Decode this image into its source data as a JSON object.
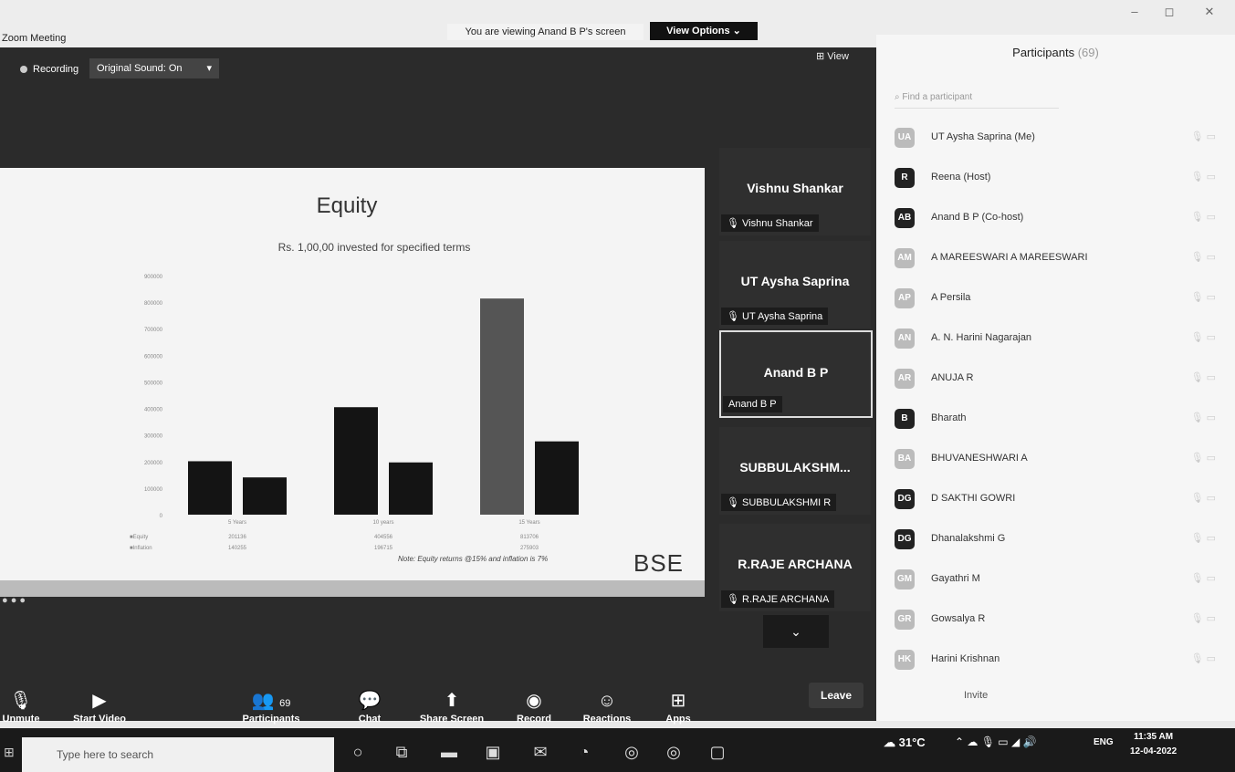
{
  "window": {
    "title": "Zoom Meeting",
    "viewing_text": "You are viewing Anand B P's screen",
    "view_options": "View Options ⌄",
    "minimize": "–",
    "maximize": "◻",
    "close": "✕"
  },
  "meeting_bar": {
    "recording": "Recording",
    "sound": "Original Sound: On",
    "sound_caret": "▾",
    "view": "⊞ View"
  },
  "slide": {
    "title": "Equity",
    "subtitle": "Rs. 1,00,00 invested for specified terms",
    "note": "Note: Equity returns @15% and inflation is 7%",
    "logo": "BSE"
  },
  "chart_data": {
    "type": "bar",
    "categories": [
      "5 Years",
      "10 years",
      "15 Years"
    ],
    "series": [
      {
        "name": "Equity",
        "values": [
          201136,
          404556,
          813706
        ]
      },
      {
        "name": "Inflation",
        "values": [
          140255,
          196715,
          275903
        ]
      }
    ],
    "yticks": [
      "900000",
      "800000",
      "700000",
      "600000",
      "500000",
      "400000",
      "300000",
      "200000",
      "100000",
      "0"
    ],
    "table_rows": [
      {
        "label": "■Equity",
        "values": [
          "201136",
          "404556",
          "813706"
        ]
      },
      {
        "label": "■Inflation",
        "values": [
          "140255",
          "196715",
          "275903"
        ]
      }
    ],
    "ylim": [
      0,
      900000
    ]
  },
  "tiles": [
    {
      "name": "Vishnu Shankar",
      "label": "Vishnu Shankar"
    },
    {
      "name": "UT Aysha Saprina",
      "label": "UT Aysha Saprina"
    },
    {
      "name": "Anand B P",
      "label": "Anand B P"
    },
    {
      "name": "SUBBULAKSHM...",
      "label": "SUBBULAKSHMI R"
    },
    {
      "name": "R.RAJE ARCHANA",
      "label": "R.RAJE ARCHANA"
    }
  ],
  "toolbar": {
    "unmute": "Unmute",
    "start_video": "Start Video",
    "participants": "Participants",
    "participants_count": "69",
    "chat": "Chat",
    "share_screen": "Share Screen",
    "record": "Record",
    "reactions": "Reactions",
    "apps": "Apps",
    "leave": "Leave"
  },
  "panel": {
    "title": "Participants",
    "count": "(69)",
    "search_placeholder": "Find a participant",
    "invite": "Invite",
    "participants": [
      {
        "initials": "UA",
        "name": "UT Aysha Saprina (Me)"
      },
      {
        "initials": "R",
        "name": "Reena (Host)"
      },
      {
        "initials": "AB",
        "name": "Anand B P (Co-host)"
      },
      {
        "initials": "AM",
        "name": "A MAREESWARI A MAREESWARI"
      },
      {
        "initials": "AP",
        "name": "A Persila"
      },
      {
        "initials": "AN",
        "name": "A. N. Harini Nagarajan"
      },
      {
        "initials": "AR",
        "name": "ANUJA R"
      },
      {
        "initials": "B",
        "name": "Bharath"
      },
      {
        "initials": "BA",
        "name": "BHUVANESHWARI A"
      },
      {
        "initials": "DG",
        "name": "D SAKTHI GOWRI"
      },
      {
        "initials": "DG",
        "name": "Dhanalakshmi G"
      },
      {
        "initials": "GM",
        "name": "Gayathri M"
      },
      {
        "initials": "GR",
        "name": "Gowsalya R"
      },
      {
        "initials": "HK",
        "name": "Harini Krishnan"
      }
    ]
  },
  "taskbar": {
    "search_placeholder": "Type here to search",
    "weather": "31°C",
    "language": "ENG",
    "time": "11:35 AM",
    "date": "12-04-2022"
  }
}
